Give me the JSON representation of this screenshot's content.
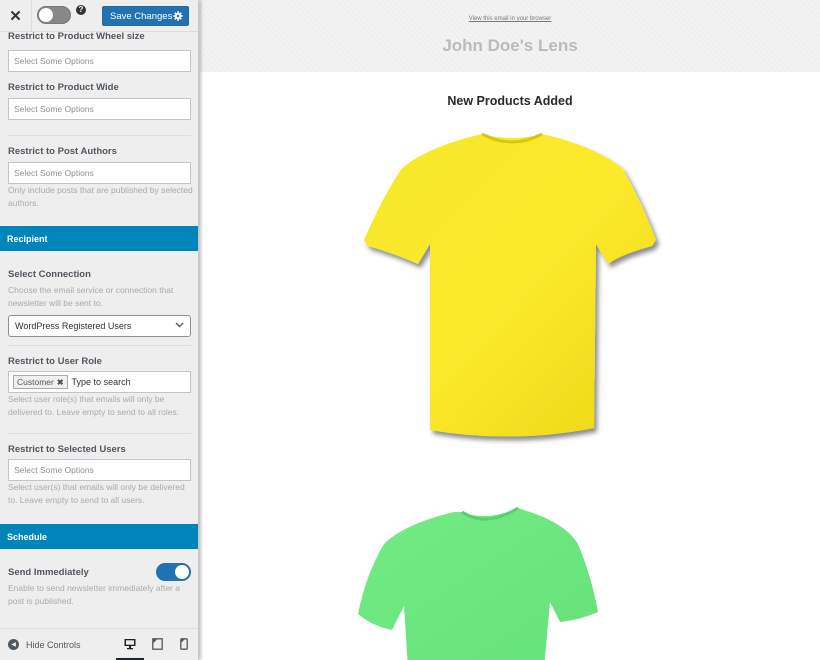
{
  "topbar": {
    "close_icon": "close-icon",
    "save_label": "Save Changes",
    "help_glyph": "?",
    "gear_glyph": "✹"
  },
  "fields": {
    "wheel_size": {
      "label": "Restrict to Product Wheel size",
      "placeholder": "Select Some Options"
    },
    "wide": {
      "label": "Restrict to Product Wide",
      "placeholder": "Select Some Options"
    },
    "post_authors": {
      "label": "Restrict to Post Authors",
      "placeholder": "Select Some Options",
      "description": "Only include posts that are published by selected authors."
    }
  },
  "recipient": {
    "header": "Recipient",
    "connection": {
      "label": "Select Connection",
      "description": "Choose the email service or connection that newsletter will be sent to.",
      "value": "WordPress Registered Users"
    },
    "user_role": {
      "label": "Restrict to User Role",
      "tags": [
        "Customer"
      ],
      "tag_remove_glyph": "✖",
      "search_placeholder": "Type to search",
      "description": "Select user role(s) that emails will only be delivered to. Leave empty to send to all roles."
    },
    "selected_users": {
      "label": "Restrict to Selected Users",
      "placeholder": "Select Some Options",
      "description": "Select user(s) that emails will only be delivered to. Leave empty to send to all users."
    }
  },
  "schedule": {
    "header": "Schedule",
    "send_immediately": {
      "label": "Send Immediately",
      "enabled": true,
      "description": "Enable to send newsletter immediately after a post is published."
    }
  },
  "footer": {
    "hide_controls_label": "Hide Controls",
    "devices": [
      "desktop",
      "tablet",
      "mobile"
    ],
    "active_device": "desktop"
  },
  "preview": {
    "view_in_browser": "View this email in your browser",
    "brand_title": "John Doe's Lens",
    "section_title": "New Products Added",
    "products": [
      {
        "name": "yellow-tshirt",
        "color": "#f5e21c"
      },
      {
        "name": "green-tshirt",
        "color": "#6fe883"
      }
    ]
  },
  "colors": {
    "accent": "#0085ba",
    "button": "#2271b1",
    "panel_bg": "#eeeeee"
  }
}
